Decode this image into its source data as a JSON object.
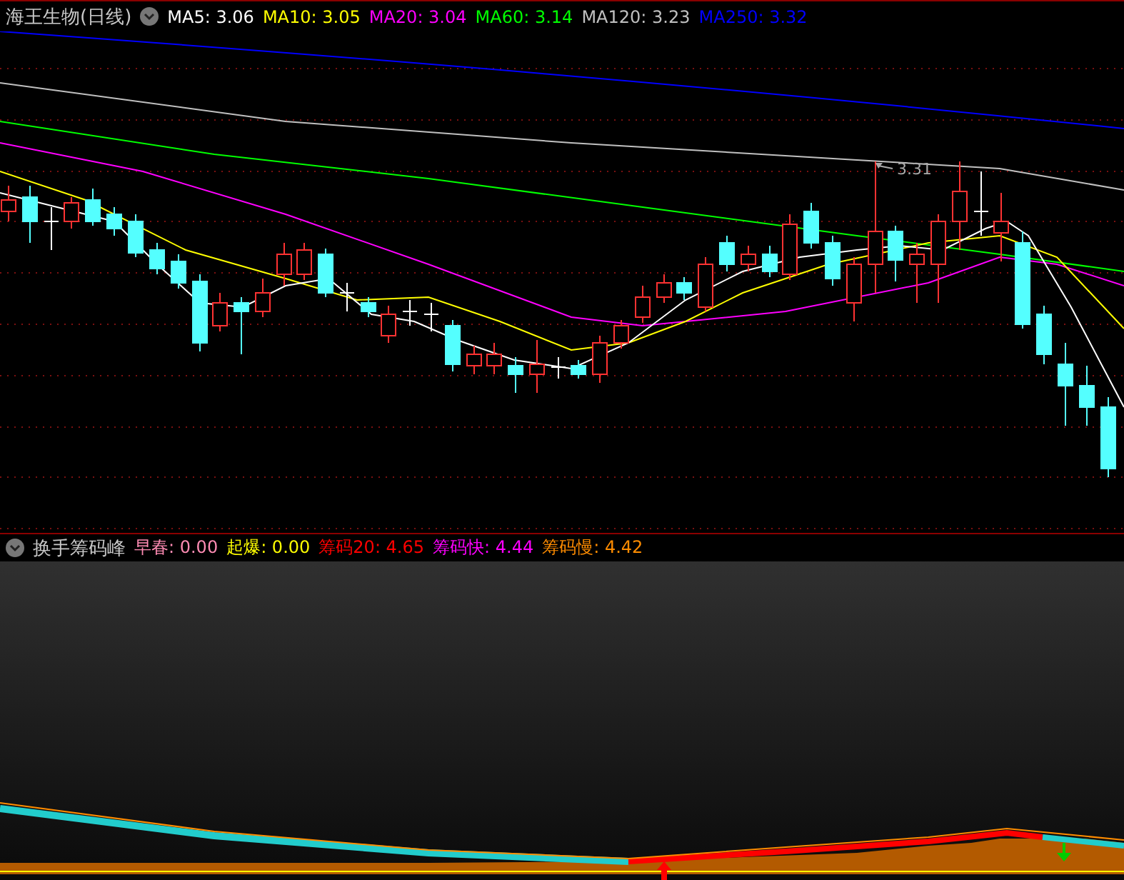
{
  "chart_header": {
    "stock": "海王生物(日线)",
    "indicators": [
      {
        "label": "MA5: 3.06",
        "color": "#ffffff"
      },
      {
        "label": "MA10: 3.05",
        "color": "#ffff00"
      },
      {
        "label": "MA20: 3.04",
        "color": "#ff00ff"
      },
      {
        "label": "MA60: 3.14",
        "color": "#00ff00"
      },
      {
        "label": "MA120: 3.23",
        "color": "#c0c0c0"
      },
      {
        "label": "MA250: 3.32",
        "color": "#0000ff"
      }
    ]
  },
  "price_chart": {
    "peak_label": "3.31"
  },
  "indicator_header": {
    "name": "换手筹码峰",
    "values": [
      {
        "label": "早春",
        "value": ": 0.00",
        "color": "#ff8cb4"
      },
      {
        "label": "起爆",
        "value": ": 0.00",
        "color": "#ffff00"
      },
      {
        "label": "筹码20",
        "value": ": 4.65",
        "color": "#ff0000"
      },
      {
        "label": "筹码快",
        "value": ": 4.44",
        "color": "#ff00ff"
      },
      {
        "label": "筹码慢",
        "value": ": 4.42",
        "color": "#ff8c00"
      }
    ]
  }
}
